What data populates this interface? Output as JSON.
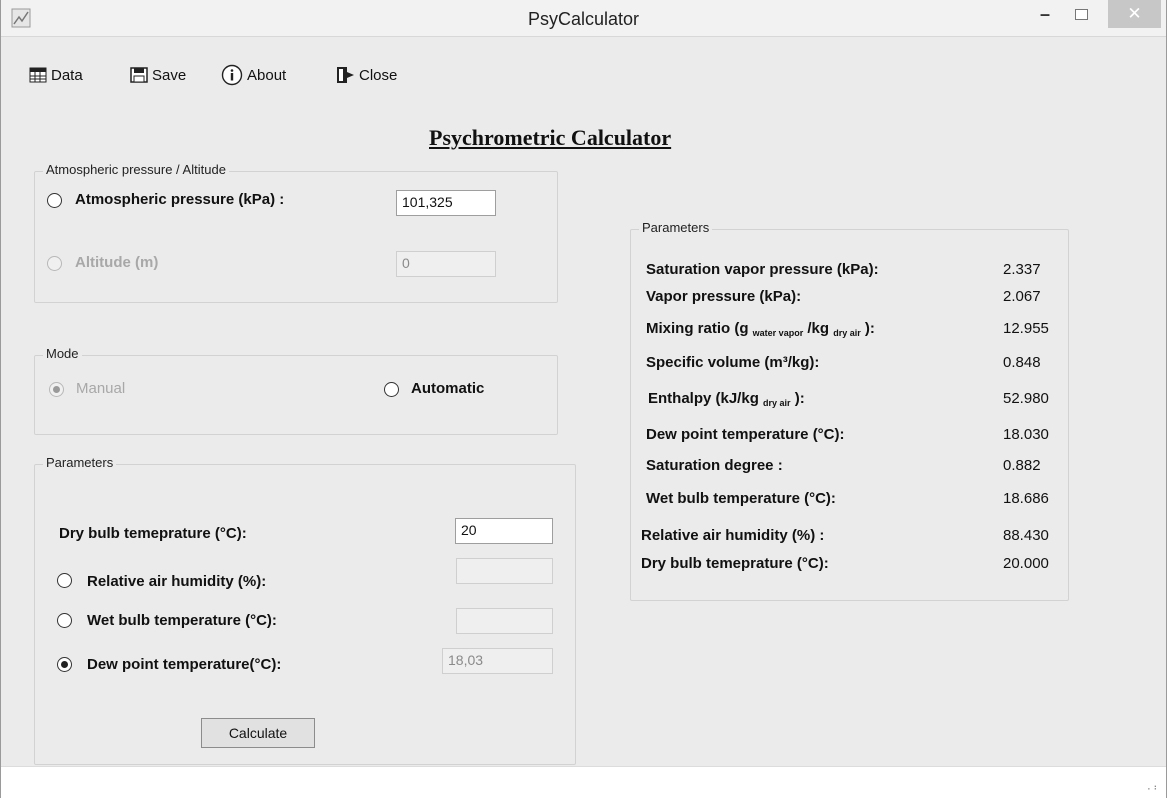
{
  "window": {
    "title": "PsyCalculator",
    "minimize_glyph": "–",
    "close_glyph": "✕"
  },
  "menu": {
    "data": "Data",
    "save": "Save",
    "about": "About",
    "close": "Close"
  },
  "heading": "Psychrometric Calculator",
  "pressure_group": {
    "legend": "Atmospheric pressure / Altitude",
    "pressure_label": "Atmospheric pressure  (kPa) :",
    "pressure_value": "101,325",
    "altitude_label": "Altitude  (m)",
    "altitude_value": "0"
  },
  "mode_group": {
    "legend": "Mode",
    "manual_label": "Manual",
    "automatic_label": "Automatic"
  },
  "input_group": {
    "legend": "Parameters",
    "dry_bulb_label": "Dry bulb temeprature (°C):",
    "dry_bulb_value": "20",
    "rh_label": "Relative air humidity (%):",
    "rh_value": "",
    "wet_bulb_label": "Wet bulb temperature (°C):",
    "wet_bulb_value": "",
    "dew_point_label": "Dew point temperature(°C):",
    "dew_point_value": "18,03",
    "calculate_button": "Calculate"
  },
  "results_group": {
    "legend": "Parameters",
    "sat_vp_label": "Saturation vapor pressure (kPa):",
    "sat_vp_value": "2.337",
    "vp_label": "Vapor pressure  (kPa):",
    "vp_value": "2.067",
    "mix_label_a": "Mixing ratio (g",
    "mix_sub_water": "water vapor",
    "mix_label_b": "/kg",
    "mix_sub_dry": "dry air",
    "mix_label_c": " ):",
    "mix_value": "12.955",
    "spec_vol_label": "Specific volume (m³/kg):",
    "spec_vol_value": "0.848",
    "enth_label_a": "Enthalpy (kJ/kg",
    "enth_sub": "dry air",
    "enth_label_b": " ):",
    "enth_value": "52.980",
    "dew_label": "Dew point temperature (°C):",
    "dew_value": "18.030",
    "sat_deg_label": "Saturation degree :",
    "sat_deg_value": "0.882",
    "wet_label": "Wet bulb temperature (°C):",
    "wet_value": "18.686",
    "rh_label": "Relative air humidity (%) :",
    "rh_value": "88.430",
    "dry_label": "Dry bulb temeprature  (°C):",
    "dry_value": "20.000"
  }
}
